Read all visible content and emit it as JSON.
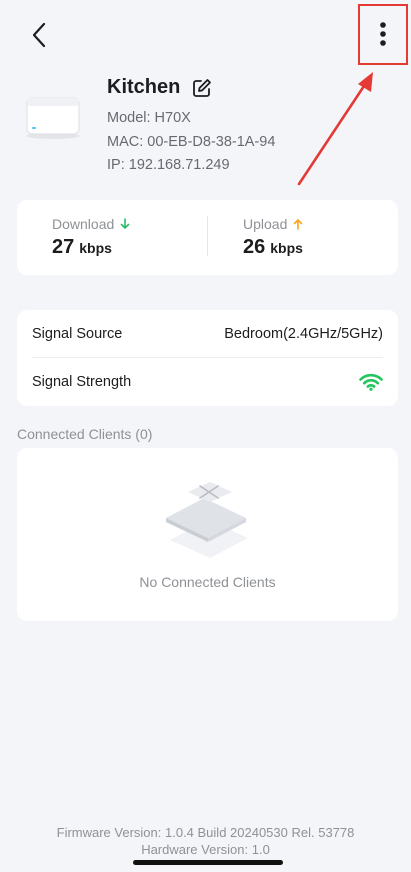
{
  "header": {
    "back_icon": "chevron-left-icon",
    "more_icon": "more-vertical-icon"
  },
  "device": {
    "name": "Kitchen",
    "edit_icon": "edit-icon",
    "model": "Model: H70X",
    "mac": "MAC: 00-EB-D8-38-1A-94",
    "ip": "IP: 192.168.71.249"
  },
  "traffic": {
    "download_label": "Download",
    "download_value": "27",
    "download_unit": "kbps",
    "upload_label": "Upload",
    "upload_value": "26",
    "upload_unit": "kbps",
    "download_color": "#2dbb6a",
    "upload_color": "#f5a623"
  },
  "signal": {
    "source_label": "Signal Source",
    "source_value": "Bedroom(2.4GHz/5GHz)",
    "strength_label": "Signal Strength",
    "strength_icon": "wifi-icon",
    "strength_color": "#22c55e"
  },
  "clients": {
    "title": "Connected Clients (0)",
    "empty_text": "No Connected Clients"
  },
  "footer": {
    "firmware": "Firmware Version: 1.0.4 Build 20240530 Rel. 53778",
    "hardware": "Hardware Version: 1.0"
  },
  "annotation": {
    "highlight_color": "#e53935"
  }
}
